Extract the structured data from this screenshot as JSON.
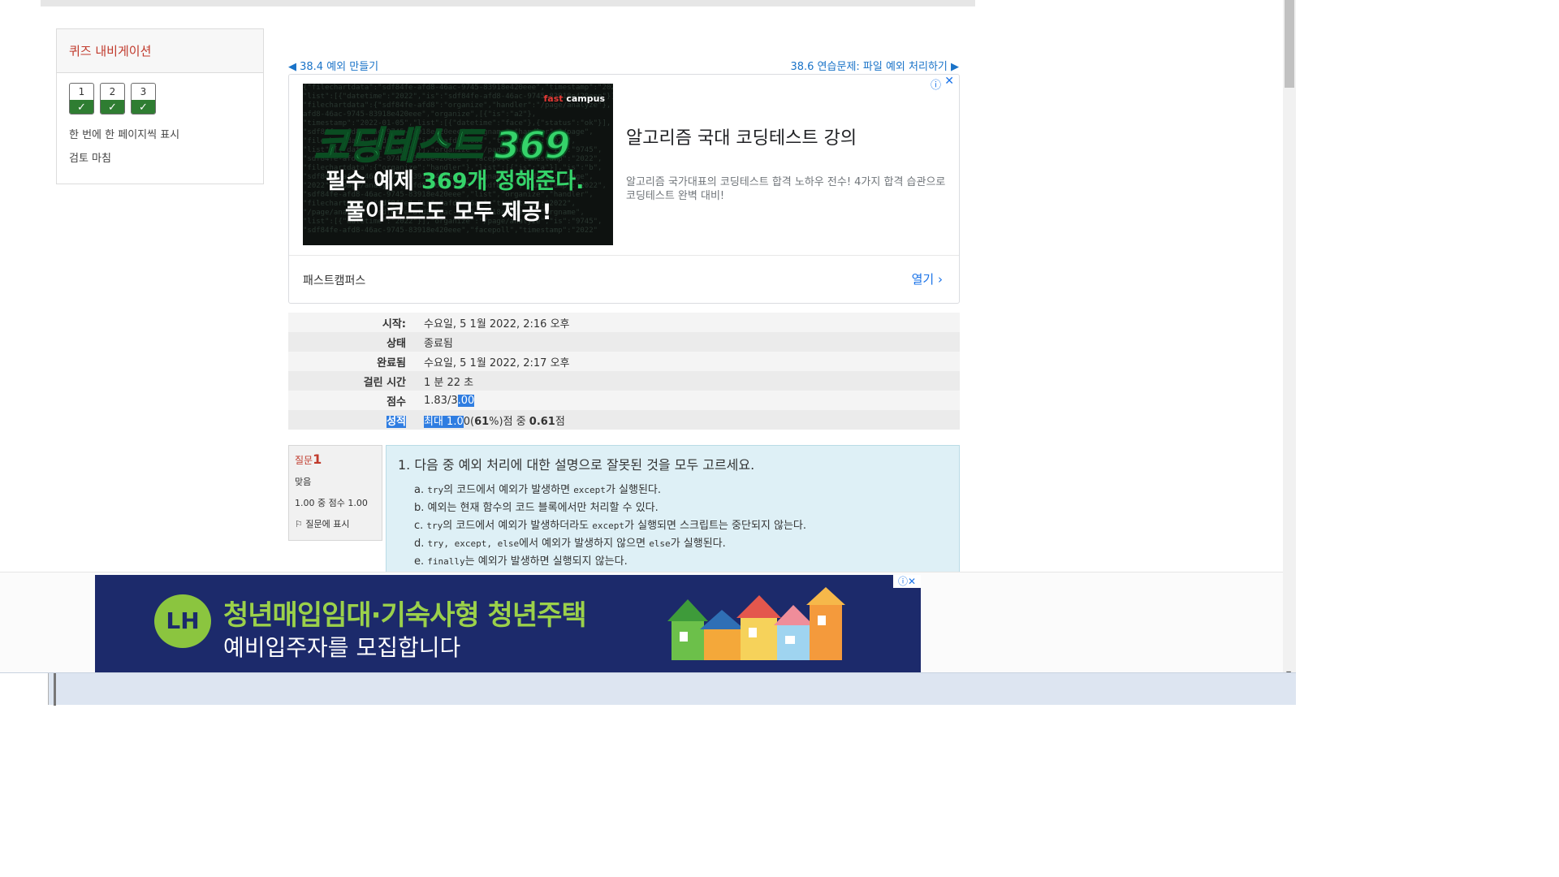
{
  "quiz_nav": {
    "title": "퀴즈 내비게이션",
    "buttons": [
      {
        "num": "1",
        "check": "✓"
      },
      {
        "num": "2",
        "check": "✓"
      },
      {
        "num": "3",
        "check": "✓"
      }
    ],
    "one_page": "한 번에 한 페이지씩 표시",
    "finish_review": "검토 마침"
  },
  "prevnext": {
    "prev": "◀ 38.4 예외 만들기",
    "next": "38.6 연습문제: 파일 예외 처리하기 ▶"
  },
  "ad": {
    "brand_prefix": "fast",
    "brand_suffix": " campus",
    "big_text": "코딩테스트 369",
    "sub1_prefix": "필수 예제 ",
    "sub1_highlight": "369개 정해준다.",
    "sub2": "풀이코드도 모두 제공!",
    "headline": "알고리즘 국대 코딩테스트 강의",
    "desc": "알고리즘 국가대표의 코딩테스트 합격 노하우 전수! 4가지 합격 습관으로 코딩테스트 완벽 대비!",
    "advertiser": "패스트캠퍼스",
    "open": "열기  ›",
    "info_icon": "ⓘ",
    "close_icon": "✕"
  },
  "summary": {
    "rows": [
      {
        "label": "시작:",
        "value": "수요일, 5 1월 2022, 2:16 오후"
      },
      {
        "label": "상태",
        "value": "종료됨"
      },
      {
        "label": "완료됨",
        "value": "수요일, 5 1월 2022, 2:17 오후"
      },
      {
        "label": "걸린 시간",
        "value": "1 분 22 초"
      }
    ],
    "score_label": "점수",
    "score_value_a": "1.83/3",
    "score_value_b": ".00",
    "grade_label": "성적",
    "grade_value_a": "최대 1.0",
    "grade_value_b": "0(",
    "grade_pct": "61",
    "grade_value_c": "%)점 중 ",
    "grade_score": "0.61",
    "grade_value_d": "점"
  },
  "question": {
    "label": "질문",
    "number": "1",
    "status": "맞음",
    "score": "1.00 중 점수 1.00",
    "flag": "질문에 표시",
    "text": "1. 다음 중 예외 처리에 대한 설명으로 잘못된 것을 모두 고르세요.",
    "options": [
      {
        "letter": "a.",
        "code1": "try",
        "t1": "의 코드에서 예외가 발생하면 ",
        "code2": "except",
        "t2": "가 실행된다."
      },
      {
        "letter": "b.",
        "code1": "",
        "t1": "예외는 현재 함수의 코드 블록에서만 처리할 수 있다.",
        "code2": "",
        "t2": ""
      },
      {
        "letter": "c.",
        "code1": "try",
        "t1": "의 코드에서 예외가 발생하더라도 ",
        "code2": "except",
        "t2": "가 실행되면 스크립트는 중단되지 않는다."
      },
      {
        "letter": "d.",
        "code1": "try, except, else",
        "t1": "에서 예외가 발생하지 않으면 ",
        "code2": "else",
        "t2": "가 실행된다."
      },
      {
        "letter": "e.",
        "code1": "finally",
        "t1": "는 예외가 발생하면 실행되지 않는다.",
        "code2": "",
        "t2": ""
      }
    ]
  },
  "bottom_ad": {
    "logo": "LH",
    "title": "청년매입임대·기숙사형 청년주택",
    "sub": "예비입주자를 모집합니다",
    "close": "ⓘ✕"
  },
  "colors": {
    "link": "#1a73c8",
    "accent_red": "#c0392b",
    "check_green": "#2f7d32",
    "highlight": "#2f7de1"
  }
}
